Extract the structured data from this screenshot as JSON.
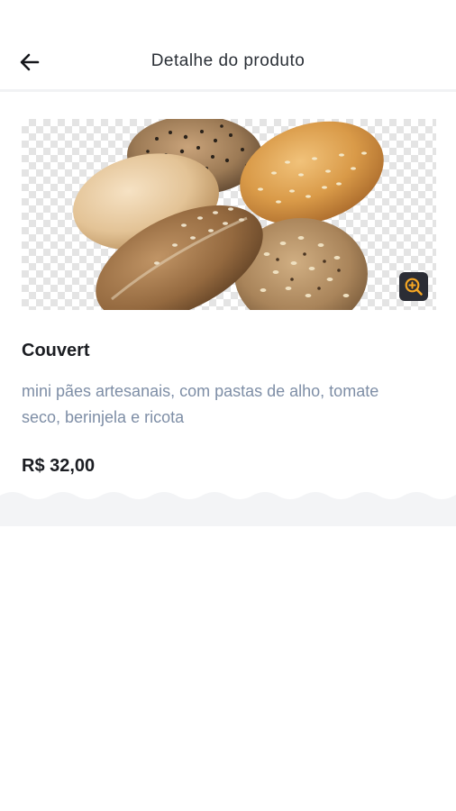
{
  "header": {
    "title": "Detalhe do produto",
    "back_icon": "arrow-left-icon"
  },
  "product": {
    "image_alt": "pães artesanais",
    "zoom_icon": "zoom-in-icon",
    "name": "Couvert",
    "description": "mini pães artesanais, com pastas de alho, tomate seco, berinjela e ricota",
    "price": "R$ 32,00"
  },
  "colors": {
    "zoom_accent": "#f5a623",
    "description_text": "#7e8ea6",
    "band_background": "#f3f4f6"
  }
}
